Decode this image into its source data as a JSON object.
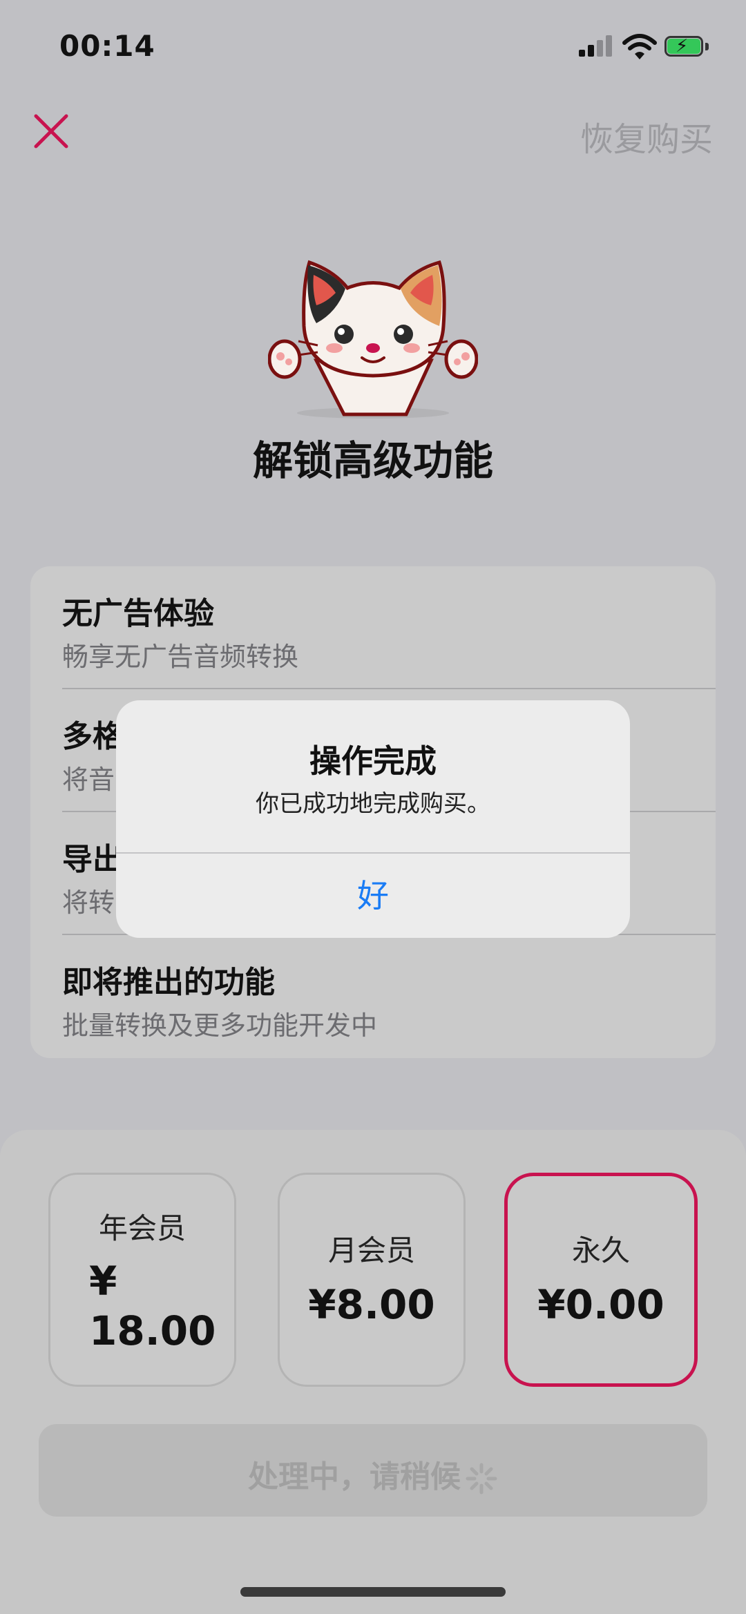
{
  "status_bar": {
    "time": "00:14"
  },
  "nav": {
    "restore_label": "恢复购买"
  },
  "hero": {
    "title": "解锁高级功能"
  },
  "features": [
    {
      "title": "无广告体验",
      "desc": "畅享无广告音频转换"
    },
    {
      "title": "多格",
      "desc": "将音"
    },
    {
      "title": "导出",
      "desc": "将转"
    },
    {
      "title": "即将推出的功能",
      "desc": "批量转换及更多功能开发中"
    }
  ],
  "plans": [
    {
      "name": "年会员",
      "price_symbol": "¥",
      "price_amount": "18.00"
    },
    {
      "name": "月会员",
      "price": "¥8.00"
    },
    {
      "name": "永久",
      "price": "¥0.00",
      "selected": true
    }
  ],
  "processing": {
    "label": "处理中，请稍候"
  },
  "alert": {
    "title": "操作完成",
    "message": "你已成功地完成购买。",
    "ok_label": "好"
  },
  "colors": {
    "accent": "#c8134f",
    "link_blue": "#1a7cf5",
    "battery_green": "#34c759"
  }
}
